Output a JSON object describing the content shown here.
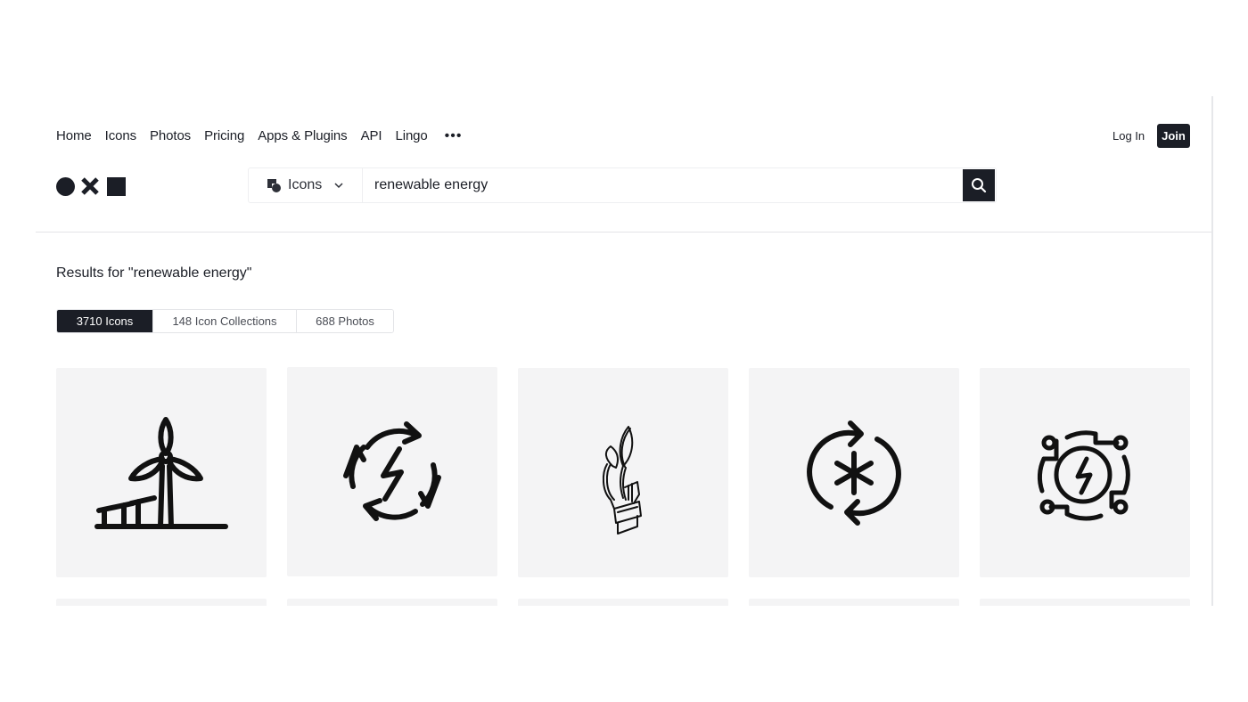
{
  "nav": {
    "items": [
      "Home",
      "Icons",
      "Photos",
      "Pricing",
      "Apps & Plugins",
      "API",
      "Lingo"
    ],
    "more": "•••"
  },
  "auth": {
    "login": "Log In",
    "join": "Join"
  },
  "search": {
    "type_label": "Icons",
    "query": "renewable energy"
  },
  "results": {
    "title": "Results for \"renewable energy\"",
    "tabs": [
      "3710 Icons",
      "148 Icon Collections",
      "688 Photos"
    ],
    "active_tab": 0
  },
  "icons": [
    {
      "name": "wind-turbine-solar-icon"
    },
    {
      "name": "recycle-energy-icon"
    },
    {
      "name": "sprout-hand-isometric-icon"
    },
    {
      "name": "renew-asterisk-icon"
    },
    {
      "name": "energy-circuit-icon"
    }
  ],
  "colors": {
    "primary": "#1b1e26",
    "card_bg": "#f4f4f5",
    "border": "#e3e4e7"
  }
}
